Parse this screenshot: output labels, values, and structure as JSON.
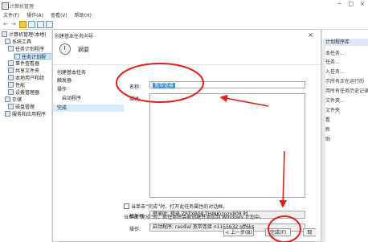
{
  "window": {
    "title": "计算机管理",
    "min": "−",
    "max": "□",
    "close": "×"
  },
  "menu": [
    "文件(F)",
    "操作(A)",
    "查看(V)",
    "帮助(H)"
  ],
  "toolbar_icons": [
    "back-arrow-icon",
    "forward-arrow-icon",
    "folder-icon",
    "properties-icon",
    "help-icon",
    "panel-icon"
  ],
  "tree": [
    "计算机管理(本地)",
    "系统工具",
    "任务计划程序",
    "任务计划程",
    "事件查看器",
    "共享文件夹",
    "本地用户和组",
    "性能",
    "设备管理器",
    "存储",
    "磁盘管理",
    "服务和应用程序"
  ],
  "actions_panel": {
    "title": "计划程序库",
    "items": [
      "本任务...",
      "任务...",
      "入任务...",
      "示所有正在运行的",
      "用所有任务历史记录",
      "文件夹...",
      "文件夹",
      "看",
      "新",
      "助"
    ]
  },
  "dialog": {
    "title": "创建基本任务向导",
    "close": "×",
    "header": "摘要",
    "steps": [
      "创建基本任务",
      "触发器",
      "操作",
      "启动程序",
      "完成"
    ],
    "name_label": "名称:",
    "name_value": "宽带连接",
    "desc_label": "描述:",
    "trigger_label": "触发器:",
    "trigger_value": "登录时; 登录 ZPZXB08-THINK\\zpzx808 时",
    "action_label": "操作:",
    "action_value": "启动程序; rasdial 宽带连接 n1155632 off6ks",
    "checkbox_text": "当单击“完成”时，打开此任务属性的对话框。",
    "hint_text": "当单击“完成”时，新任务将会被创建并添加到 Windows 计划中。",
    "back_button": "< 上一步(B)",
    "finish_button": "完成(F)",
    "cancel_button": "取"
  },
  "annotation_colors": {
    "red": "#e02020"
  }
}
